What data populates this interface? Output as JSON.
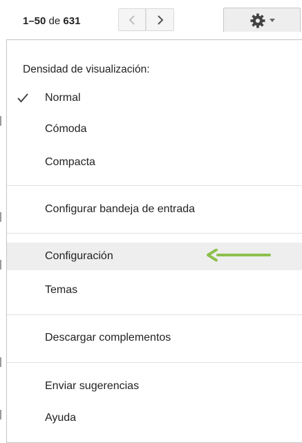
{
  "pager": {
    "range": "1–50",
    "of_word": "de",
    "total": "631"
  },
  "toolbar": {
    "prev_icon": "chevron-left-icon",
    "next_icon": "chevron-right-icon",
    "settings_icon": "gear-icon",
    "settings_caret_icon": "caret-down-icon"
  },
  "menu": {
    "density_heading": "Densidad de visualización:",
    "density_options": [
      {
        "label": "Normal",
        "checked": true
      },
      {
        "label": "Cómoda",
        "checked": false
      },
      {
        "label": "Compacta",
        "checked": false
      }
    ],
    "configure_inbox": "Configurar bandeja de entrada",
    "settings": "Configuración",
    "themes": "Temas",
    "get_addons": "Descargar complementos",
    "send_feedback": "Enviar sugerencias",
    "help": "Ayuda"
  },
  "colors": {
    "highlight": "#eeeeee",
    "annotation_arrow": "#8dc04b",
    "divider": "#e0e0e0"
  }
}
